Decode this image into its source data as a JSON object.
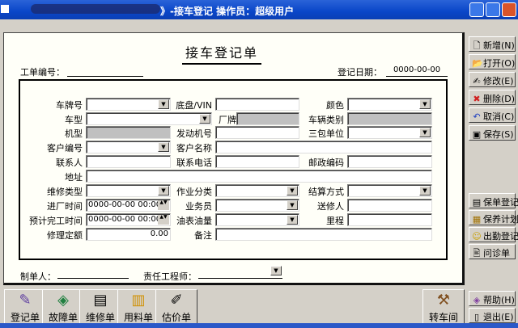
{
  "window": {
    "title": "》-接车登记    操作员：超级用户",
    "min": "_",
    "max": "□",
    "close": "X"
  },
  "form": {
    "title": "接车登记单",
    "order_no_label": "工单编号：",
    "order_no": "",
    "reg_date_label": "登记日期：",
    "reg_date": "0000-00-00",
    "fields": {
      "plate": {
        "label": "车牌号",
        "value": ""
      },
      "vin": {
        "label": "底盘/VIN",
        "value": ""
      },
      "color": {
        "label": "颜色",
        "value": ""
      },
      "model": {
        "label": "车型",
        "value": ""
      },
      "brand": {
        "label": "厂牌",
        "value": ""
      },
      "vehicle_class": {
        "label": "车辆类别",
        "value": ""
      },
      "engine_type": {
        "label": "机型",
        "value": ""
      },
      "engine_no": {
        "label": "发动机号",
        "value": ""
      },
      "warranty_unit": {
        "label": "三包单位",
        "value": ""
      },
      "customer_no": {
        "label": "客户编号",
        "value": ""
      },
      "customer_name": {
        "label": "客户名称",
        "value": ""
      },
      "contact": {
        "label": "联系人",
        "value": ""
      },
      "phone": {
        "label": "联系电话",
        "value": ""
      },
      "postcode": {
        "label": "邮政编码",
        "value": ""
      },
      "address": {
        "label": "地址",
        "value": ""
      },
      "repair_type": {
        "label": "维修类型",
        "value": ""
      },
      "work_class": {
        "label": "作业分类",
        "value": ""
      },
      "settle": {
        "label": "结算方式",
        "value": ""
      },
      "in_time": {
        "label": "进厂时间",
        "value": "0000-00-00 00:00"
      },
      "salesman": {
        "label": "业务员",
        "value": ""
      },
      "sender": {
        "label": "送修人",
        "value": ""
      },
      "eta": {
        "label": "预计完工时间",
        "value": "0000-00-00 00:00"
      },
      "fuel": {
        "label": "油表油量",
        "value": ""
      },
      "mileage": {
        "label": "里程",
        "value": ""
      },
      "quota": {
        "label": "修理定额",
        "value": "0.00"
      },
      "remark": {
        "label": "备注",
        "value": ""
      }
    },
    "maker_label": "制单人：",
    "maker": "",
    "engineer_label": "责任工程师：",
    "engineer": ""
  },
  "sidebar": {
    "top": [
      {
        "label": "新增(N)",
        "icon": "new-doc-icon"
      },
      {
        "label": "打开(O)",
        "icon": "open-folder-icon"
      },
      {
        "label": "修改(E)",
        "icon": "edit-icon"
      },
      {
        "label": "删除(D)",
        "icon": "delete-icon"
      },
      {
        "label": "取消(C)",
        "icon": "undo-icon"
      },
      {
        "label": "保存(S)",
        "icon": "save-icon"
      }
    ],
    "mid": [
      {
        "label": "保单登记"
      },
      {
        "label": "保养计划"
      },
      {
        "label": "出勤登记"
      },
      {
        "label": "问诊单"
      }
    ],
    "bottom": [
      {
        "label": "帮助(H)"
      },
      {
        "label": "退出(E)"
      }
    ]
  },
  "toolbar": [
    {
      "label": "登记单"
    },
    {
      "label": "故障单"
    },
    {
      "label": "维修单"
    },
    {
      "label": "用料单"
    },
    {
      "label": "估价单"
    },
    {
      "label": "转车间"
    }
  ]
}
